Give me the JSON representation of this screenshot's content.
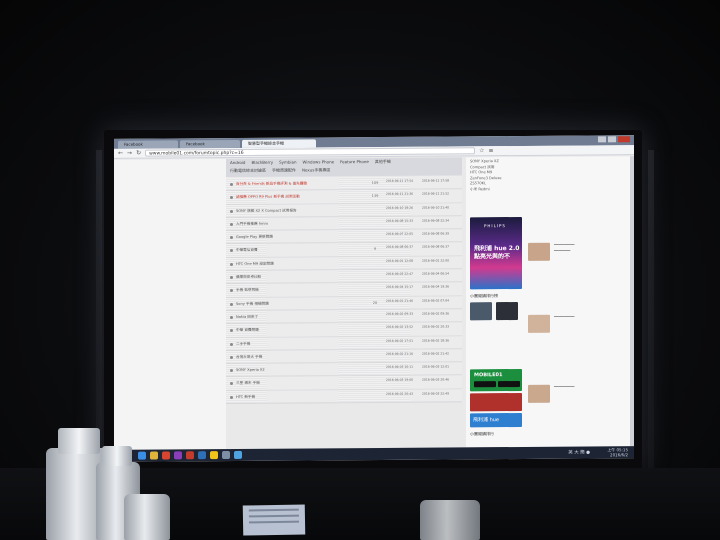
{
  "browser": {
    "tabs": [
      {
        "label": "Facebook"
      },
      {
        "label": "Facebook"
      },
      {
        "label": "智慧型手機綜合手機"
      }
    ],
    "url": "www.mobile01.com/forumtopic.php?c=16"
  },
  "site_nav": {
    "row1": [
      "Android",
      "BlackBerry",
      "Symbian",
      "Windows Phone",
      "Feature Phone",
      "其他手機"
    ],
    "row2": [
      "行動電信綜合討論區",
      "手機周邊配件",
      "Nexus手機專區"
    ]
  },
  "threads": [
    {
      "title": "百分百 & Friends 新品手機評測 & 搶先體驗",
      "count": "109",
      "meta": "2016-06-11 17:54",
      "meta2": "2016-06-11 17:58",
      "hot": true
    },
    {
      "title": "請推薦 OPPO R9 Plus 新手機 試用活動",
      "count": "139",
      "meta": "2016-06-11 21:36",
      "meta2": "2016-06-11 21:52",
      "hot": true
    },
    {
      "title": "SONY 旗艦 X2 X Compact 試用報告",
      "count": "",
      "meta": "2016-06-10 18:26",
      "meta2": "2016-06-10 21:40",
      "hot": false
    },
    {
      "title": "入門手機推薦 hmm",
      "count": "",
      "meta": "2016-06-08 15:33",
      "meta2": "2016-06-08 22:34",
      "hot": false
    },
    {
      "title": "Google Play 更新問題",
      "count": "",
      "meta": "2016-06-07 22:05",
      "meta2": "2016-06-08 06:39",
      "hot": false
    },
    {
      "title": "中華電信資費",
      "count": "9",
      "meta": "2016-06-08 06:37",
      "meta2": "2016-06-08 06:37",
      "hot": false
    },
    {
      "title": "HTC One M9 設定問題",
      "count": "",
      "meta": "2016-06-01 12:08",
      "meta2": "2016-06-01 22:00",
      "hot": false
    },
    {
      "title": "蘋果與安卓比較",
      "count": "",
      "meta": "2016-06-03 22:47",
      "meta2": "2016-06-04 06:54",
      "hot": false
    },
    {
      "title": "手機 藍芽耳機",
      "count": "",
      "meta": "2016-06-04 15:17",
      "meta2": "2016-06-04 19:36",
      "hot": false
    },
    {
      "title": "Sony 手機 相機問題",
      "count": "20",
      "meta": "2016-06-01 21:46",
      "meta2": "2016-06-02 07:04",
      "hot": false
    },
    {
      "title": "Nokia 回來了",
      "count": "",
      "meta": "2016-06-02 09:33",
      "meta2": "2016-06-02 09:36",
      "hot": false
    },
    {
      "title": "中華 資費問題",
      "count": "",
      "meta": "2016-06-02 13:52",
      "meta2": "2016-06-02 20:33",
      "hot": false
    },
    {
      "title": "二手手機",
      "count": "",
      "meta": "2016-06-02 17:51",
      "meta2": "2016-06-02 18:36",
      "hot": false
    },
    {
      "title": "台灣大哥大 手機",
      "count": "",
      "meta": "2016-06-02 21:16",
      "meta2": "2016-06-02 21:42",
      "hot": false
    },
    {
      "title": "SONY Xperia X2",
      "count": "",
      "meta": "2016-06-03 10:11",
      "meta2": "2016-06-03 12:01",
      "hot": false
    },
    {
      "title": "三星 週末 手機",
      "count": "",
      "meta": "2016-06-03 19:00",
      "meta2": "2016-06-03 20:46",
      "hot": false
    },
    {
      "title": "HTC 新手機",
      "count": "",
      "meta": "2016-06-02 20:43",
      "meta2": "2016-06-03 22:49",
      "hot": false
    }
  ],
  "sidebar": {
    "links": [
      "SONY Xperia XZ",
      "Compact 試用",
      "HTC One M9",
      "ZenFone3 Deluxe",
      "ZS570KL",
      "小米 Redmi"
    ],
    "philips_ad": {
      "brand": "PHILIPS",
      "headline": "飛利浦 hue 2.0",
      "sub": "點亮光與的不"
    },
    "heading_gallery": "小圖閱讀排行榜",
    "mobile01_ad": {
      "brand": "MOBILE01"
    },
    "blue_ad": {
      "headline": "飛利浦 hue"
    },
    "heading_more": "小圖閱讀排行"
  },
  "taskbar": {
    "lang": "英 大 簡 ●",
    "time": "上午 05:15",
    "date": "2016/6/2"
  },
  "colors": {
    "screen_bg": "#e9e9ea",
    "hot_title": "#c0392b",
    "taskbar": "#1d2434"
  }
}
